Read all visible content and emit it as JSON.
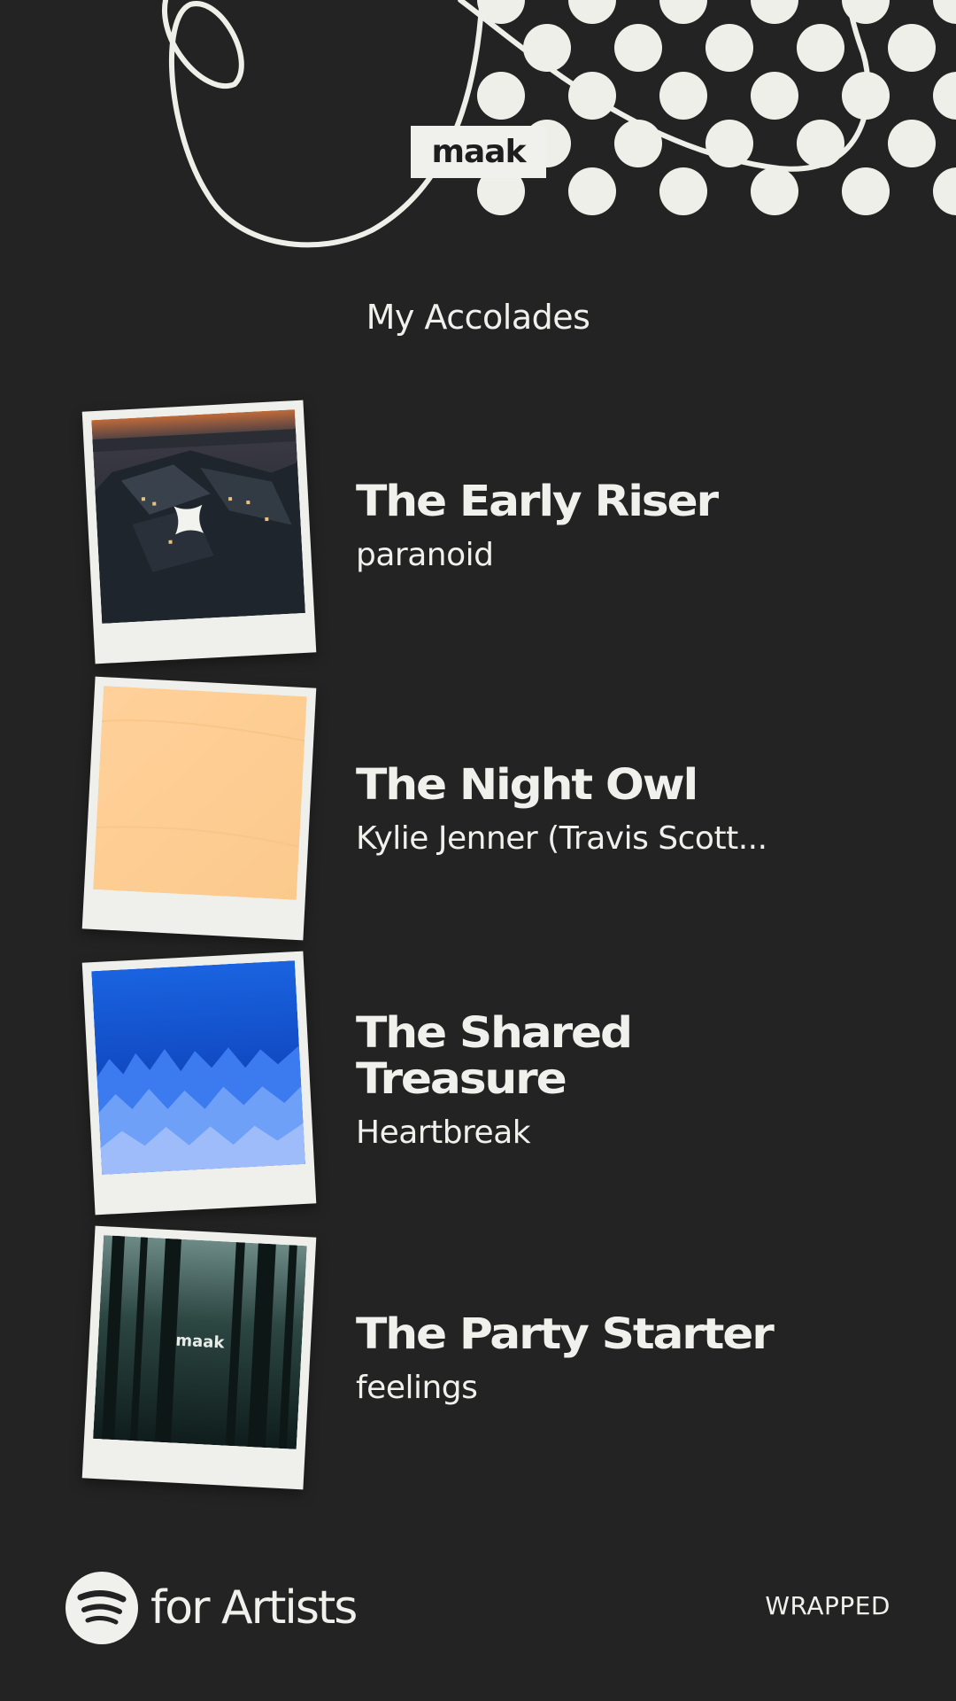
{
  "header": {
    "artist_tag": "maak",
    "section_title": "My Accolades"
  },
  "accolades": [
    {
      "title": "The Early Riser",
      "subtitle": "paranoid",
      "cover": "night-city-aerial"
    },
    {
      "title": "The Night Owl",
      "subtitle": "Kylie Jenner (Travis Scott...",
      "cover": "peach-paper"
    },
    {
      "title": "The Shared Treasure",
      "subtitle": "Heartbreak",
      "cover": "blue-forest"
    },
    {
      "title": "The Party Starter",
      "subtitle": "feelings",
      "cover": "dark-forest",
      "cover_text": "maak"
    }
  ],
  "footer": {
    "logo_icon": "spotify-icon",
    "brand_label": "for Artists",
    "wrapped_label": "WRAPPED"
  },
  "colors": {
    "background": "#232323",
    "foreground": "#f0f0ec"
  }
}
